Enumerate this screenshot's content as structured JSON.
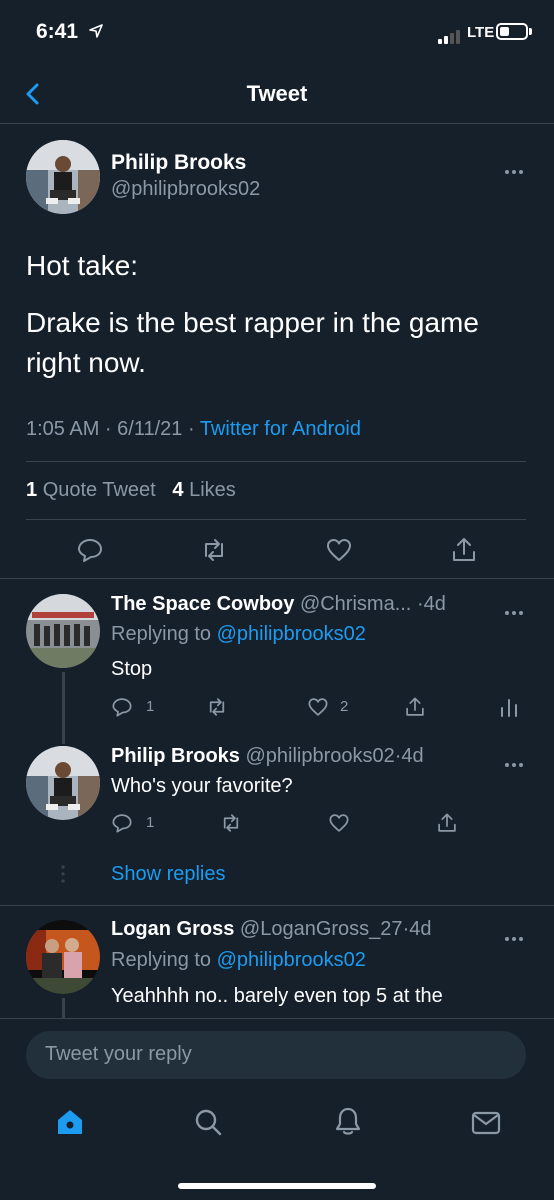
{
  "status_bar": {
    "time": "6:41",
    "network": "LTE"
  },
  "header": {
    "title": "Tweet"
  },
  "main_tweet": {
    "name": "Philip Brooks",
    "handle": "@philipbrooks02",
    "text_line1": "Hot take:",
    "text_line2": "Drake is the best rapper in the game right now.",
    "timestamp": "1:05 AM · 6/11/21 · ",
    "source": "Twitter for Android",
    "quote_count": "1",
    "quote_label": "Quote Tweet",
    "like_count": "4",
    "like_label": "Likes"
  },
  "replies": [
    {
      "name": "The Space Cowboy",
      "handle": "@Chrisma...",
      "age": "·4d",
      "replying_prefix": "Replying to ",
      "replying_to": "@philipbrooks02",
      "text": "Stop",
      "reply_count": "1",
      "like_count": "2"
    },
    {
      "name": "Philip Brooks",
      "handle": "@philipbrooks02",
      "age": "·4d",
      "text": "Who's your favorite?",
      "reply_count": "1"
    },
    {
      "name": "Logan Gross",
      "handle": "@LoganGross_27",
      "age": "·4d",
      "replying_prefix": "Replying to ",
      "replying_to": "@philipbrooks02",
      "text": "Yeahhhh no.. barely even top 5 at the"
    }
  ],
  "show_replies": "Show replies",
  "compose": {
    "placeholder": "Tweet your reply"
  },
  "tab_bar": [
    "home-icon",
    "search-icon",
    "notifications-icon",
    "messages-icon"
  ],
  "colors": {
    "background": "#15202b",
    "accent": "#1d9bf0",
    "secondary_text": "#8b98a5",
    "divider": "#38444d"
  }
}
